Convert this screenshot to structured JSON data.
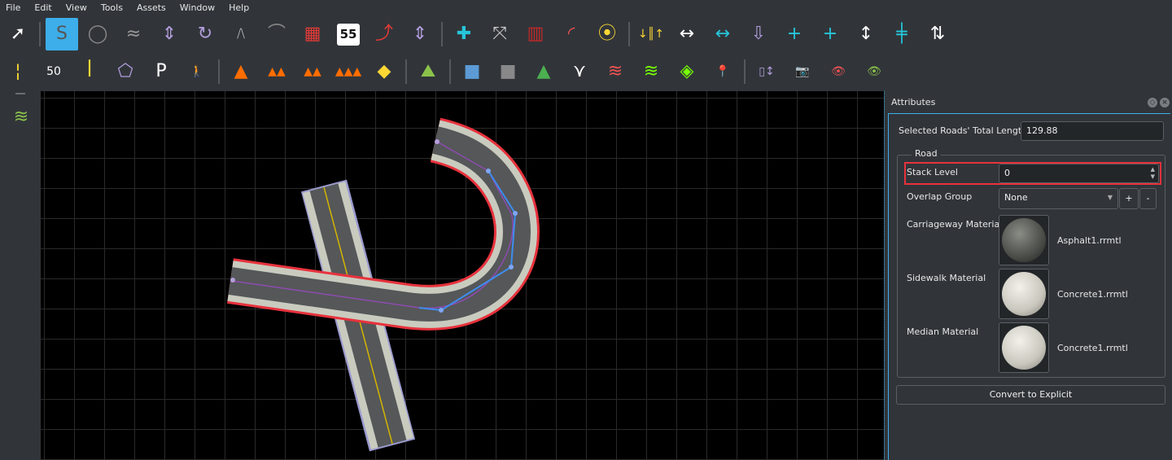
{
  "menu": [
    "File",
    "Edit",
    "View",
    "Tools",
    "Assets",
    "Window",
    "Help"
  ],
  "toolbar": {
    "row1": [
      {
        "icon": "select-arrow-icon",
        "glyph": "➚",
        "color": "#ffffff"
      },
      {
        "sep": true
      },
      {
        "icon": "road-plan-icon",
        "glyph": "S",
        "color": "#555",
        "active": true
      },
      {
        "icon": "roundabout-icon",
        "glyph": "◯",
        "color": "#8a8a8a"
      },
      {
        "icon": "road-elevation-spline-icon",
        "glyph": "≈",
        "color": "#999"
      },
      {
        "icon": "elevation-tool-icon",
        "glyph": "⇕",
        "color": "#b39ddb"
      },
      {
        "icon": "superelevation-icon",
        "glyph": "↻",
        "color": "#b39ddb"
      },
      {
        "icon": "cross-section-icon",
        "glyph": "⧸⧹",
        "color": "#ccc"
      },
      {
        "icon": "bridge-span-icon",
        "glyph": "⌒",
        "color": "#888"
      },
      {
        "icon": "road-groups-heatmap-icon",
        "glyph": "▦",
        "color": "#e53935"
      },
      {
        "icon": "speed-limit-sign-icon",
        "glyph": "55",
        "color": "#111",
        "bg": "#fff"
      },
      {
        "icon": "lane-carve-icon",
        "glyph": "⤴",
        "color": "#e53935"
      },
      {
        "icon": "lane-width-icon",
        "glyph": "⇕",
        "color": "#b39ddb"
      },
      {
        "sep": true
      },
      {
        "icon": "junction-add-icon",
        "glyph": "✚",
        "color": "#26c6da"
      },
      {
        "icon": "junction-connect-icon",
        "glyph": "⤧",
        "color": "#ccc"
      },
      {
        "icon": "junction-lanes-icon",
        "glyph": "▥",
        "color": "#c62828"
      },
      {
        "icon": "junction-corner-icon",
        "glyph": "◜",
        "color": "#ef5350"
      },
      {
        "icon": "traffic-signal-icon",
        "glyph": "⦿",
        "color": "#fdd835"
      },
      {
        "sep": true
      },
      {
        "icon": "lane-direction-icon",
        "glyph": "↓║↑",
        "color": "#fdd835"
      },
      {
        "icon": "lane-width-adjust-icon",
        "glyph": "↔",
        "color": "#fff"
      },
      {
        "icon": "lane-form-icon",
        "glyph": "↔",
        "color": "#26c6da"
      },
      {
        "icon": "lane-offset-icon",
        "glyph": "⇩",
        "color": "#b39ddb"
      },
      {
        "icon": "add-lane-icon",
        "glyph": "+",
        "color": "#26c6da"
      },
      {
        "icon": "add-lane-taper-icon",
        "glyph": "+",
        "color": "#26c6da"
      },
      {
        "icon": "lane-chop-icon",
        "glyph": "↕",
        "color": "#fff"
      },
      {
        "icon": "lane-split-icon",
        "glyph": "╪",
        "color": "#26c6da"
      },
      {
        "icon": "lane-insert-icon",
        "glyph": "⇅",
        "color": "#fff"
      }
    ],
    "row2": [
      {
        "icon": "lane-marking-icon",
        "glyph": "¦",
        "color": "#fdd835"
      },
      {
        "icon": "marking-point-icon",
        "glyph": "50",
        "color": "#fff"
      },
      {
        "icon": "marking-curve-icon",
        "glyph": "ꟾ",
        "color": "#fdd835"
      },
      {
        "icon": "surface-marking-polygon-icon",
        "glyph": "⬠",
        "color": "#b39ddb"
      },
      {
        "icon": "parking-icon",
        "glyph": "P",
        "color": "#fff"
      },
      {
        "icon": "crosswalk-icon",
        "glyph": "🚶",
        "color": "#fff"
      },
      {
        "sep": true
      },
      {
        "icon": "traffic-cone-icon",
        "glyph": "▲",
        "color": "#ff6d00"
      },
      {
        "icon": "prop-spline-icon",
        "glyph": "▲▲",
        "color": "#ff6d00"
      },
      {
        "icon": "prop-polygon-icon",
        "glyph": "▲▲",
        "color": "#ff6d00"
      },
      {
        "icon": "prop-set-icon",
        "glyph": "▲▲▲",
        "color": "#ff6d00"
      },
      {
        "icon": "sign-icon",
        "glyph": "◆",
        "color": "#fdd835"
      },
      {
        "sep": true
      },
      {
        "icon": "terrain-icon",
        "glyph": "⛰",
        "color": "#8bc34a"
      },
      {
        "sep": true
      },
      {
        "icon": "map-imagery-icon",
        "glyph": "■",
        "color": "#5c9bd6"
      },
      {
        "icon": "elevation-map-icon",
        "glyph": "■",
        "color": "#888"
      },
      {
        "icon": "point-cloud-icon",
        "glyph": "▲",
        "color": "#4caf50"
      },
      {
        "icon": "serialized-graph-icon",
        "glyph": "⋎",
        "color": "#fff"
      },
      {
        "icon": "layers-road-icon",
        "glyph": "≋",
        "color": "#ef5350"
      },
      {
        "icon": "layers-lanes-icon",
        "glyph": "≋",
        "color": "#76ff03"
      },
      {
        "icon": "layers-points-icon",
        "glyph": "◈",
        "color": "#76ff03"
      },
      {
        "icon": "layers-location-icon",
        "glyph": "📍",
        "color": "#26c6da"
      },
      {
        "sep": true
      },
      {
        "icon": "measure-icon",
        "glyph": "▯↕",
        "color": "#b39ddb"
      },
      {
        "icon": "camera-icon",
        "glyph": "📷",
        "color": "#ccc"
      },
      {
        "icon": "view-road-icon",
        "glyph": "👁",
        "color": "#ef5350"
      },
      {
        "icon": "view-terrain-icon",
        "glyph": "👁",
        "color": "#8bc34a"
      }
    ]
  },
  "leftbar": {
    "icon": "road-stack-icon",
    "glyph": "≋",
    "color": "#8bc34a"
  },
  "panel": {
    "title": "Attributes",
    "total_length_label": "Selected Roads' Total Length",
    "total_length_value": "129.88",
    "group_title": "Road",
    "stack_level_label": "Stack Level",
    "stack_level_value": "0",
    "overlap_group_label": "Overlap Group",
    "overlap_group_value": "None",
    "add_label": "+",
    "remove_label": "-",
    "carriageway_label": "Carriageway Material",
    "carriageway_value": "Asphalt1.rrmtl",
    "sidewalk_label": "Sidewalk Material",
    "sidewalk_value": "Concrete1.rrmtl",
    "median_label": "Median Material",
    "median_value": "Concrete1.rrmtl",
    "convert_label": "Convert to Explicit"
  },
  "colors": {
    "accent": "#3daee9",
    "selection": "#e8323c",
    "road": "#555759",
    "sidewalk": "#c9cbbf",
    "lane_line": "#d4b400"
  }
}
